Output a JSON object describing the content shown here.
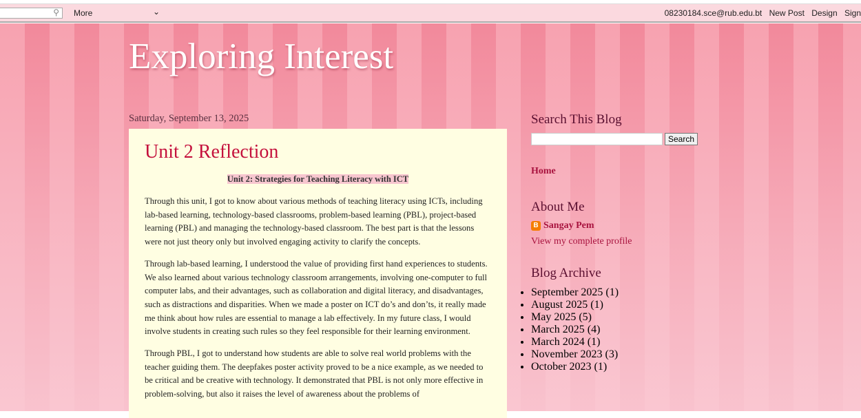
{
  "topbar": {
    "more": "More",
    "email": "08230184.sce@rub.edu.bt",
    "new_post": "New Post",
    "design": "Design",
    "sign": "Sign"
  },
  "blog_title": "Exploring Interest",
  "post": {
    "date": "Saturday, September 13, 2025",
    "title": "Unit 2 Reflection",
    "subtitle": "Unit 2: Strategies for Teaching Literacy with ICT",
    "paragraphs": [
      "Through this unit, I got to know about various methods of teaching literacy using ICTs, including lab-based learning, technology-based classrooms, problem-based learning (PBL), project-based learning (PBL) and managing the technology-based classroom. The best part is that the lessons were not just theory only but involved engaging activity to clarify the concepts.",
      "Through lab-based learning, I understood the value of providing first hand experiences to students. We also learned about various technology classroom arrangements, involving one-computer to full computer labs, and their advantages, such as collaboration and digital literacy, and disadvantages, such as distractions and disparities. When we made a poster on ICT do’s and don’ts, it really made me think about how rules are essential to manage a lab effectively. In my future class, I would involve students in creating such rules so they feel responsible for their learning environment.",
      "Through PBL, I got to understand how students are able to solve real world problems with the teacher guiding them. The deepfakes poster activity proved to be a nice example, as we needed to be critical and be creative with technology. It demonstrated that PBL is not only more effective in problem-solving, but also it raises the level of awareness about the problems of"
    ]
  },
  "sidebar": {
    "search_title": "Search This Blog",
    "search_button": "Search",
    "home": "Home",
    "about_title": "About Me",
    "profile_name": "Sangay Pem",
    "profile_link": "View my complete profile",
    "archive_title": "Blog Archive",
    "archive": [
      {
        "label": "September 2025",
        "count": "(1)"
      },
      {
        "label": "August 2025",
        "count": "(1)"
      },
      {
        "label": "May 2025",
        "count": "(5)"
      },
      {
        "label": "March 2025",
        "count": "(4)"
      },
      {
        "label": "March 2024",
        "count": "(1)"
      },
      {
        "label": "November 2023",
        "count": "(3)"
      },
      {
        "label": "October 2023",
        "count": "(1)"
      }
    ]
  }
}
